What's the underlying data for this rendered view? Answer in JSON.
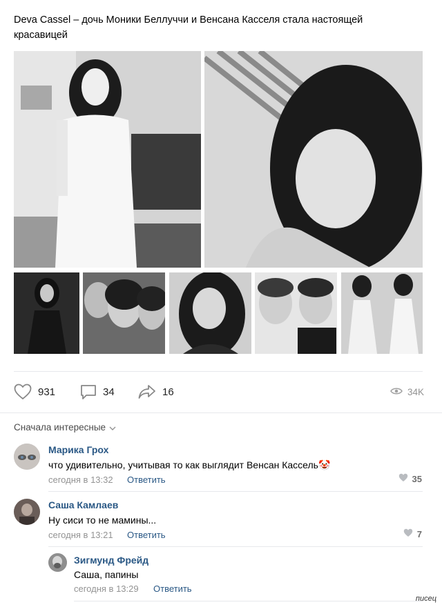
{
  "post": {
    "text": "Deva Cassel – дочь Моники Беллуччи и Венсана Касселя стала настоящей красавицей"
  },
  "actions": {
    "likes": "931",
    "comments": "34",
    "shares": "16",
    "views": "34K"
  },
  "comments_sort": {
    "label": "Сначала интересные"
  },
  "comments": [
    {
      "author": "Марика Грох",
      "text": "что удивительно, учитывая то как выглядит Венсан Кассель",
      "emoji": "🤡",
      "time": "сегодня в 13:32",
      "reply_label": "Ответить",
      "likes": "35"
    },
    {
      "author": "Саша Камлаев",
      "text": "Ну сиси то не мамины...",
      "time": "сегодня в 13:21",
      "reply_label": "Ответить",
      "likes": "7"
    },
    {
      "author": "Зигмунд Фрейд",
      "text": "Саша, папины",
      "time": "сегодня в 13:29",
      "reply_label": "Ответить"
    }
  ],
  "watermark": "писец",
  "icons": {
    "like": "heart-icon",
    "comment": "comment-bubble-icon",
    "share": "share-arrow-icon",
    "views": "eye-icon",
    "sort": "chevron-down-icon",
    "comment_like": "heart-icon"
  }
}
